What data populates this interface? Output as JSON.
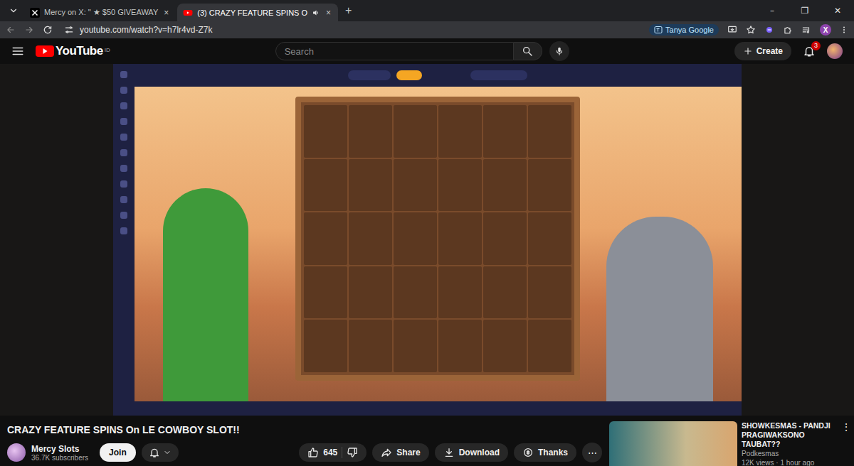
{
  "browser": {
    "tabs": [
      {
        "label": "Mercy on X: \" ★ $50 GIVEAWAY",
        "close": "×",
        "selected": false
      },
      {
        "label": "(3) CRAZY FEATURE SPINS O",
        "close": "×",
        "selected": true
      }
    ],
    "new_tab": "+",
    "address": "youtube.com/watch?v=h7lr4vd-Z7k",
    "profile_chip": "Tanya Google",
    "profile_initial": "X",
    "window_controls": [
      "–",
      "❐",
      "✕"
    ]
  },
  "youtube": {
    "logo": "YouTube",
    "region": "ID",
    "search": {
      "placeholder": "Search"
    },
    "create": "Create",
    "notifications": "3"
  },
  "video": {
    "title": "CRAZY FEATURE SPINS On LE COWBOY SLOT!!",
    "channel": "Mercy Slots",
    "subscribers": "36.7K subscribers",
    "join": "Join",
    "likes": "645",
    "actions": [
      "Share",
      "Download",
      "Thanks"
    ],
    "more": "⋯"
  },
  "recommended": [
    {
      "title": "SHOWKESMAS - PANDJI PRAGIWAKSONO TAUBAT??",
      "channel": "Podkesmas",
      "meta": "12K views · 1 hour ago",
      "more": "⋮"
    }
  ]
}
